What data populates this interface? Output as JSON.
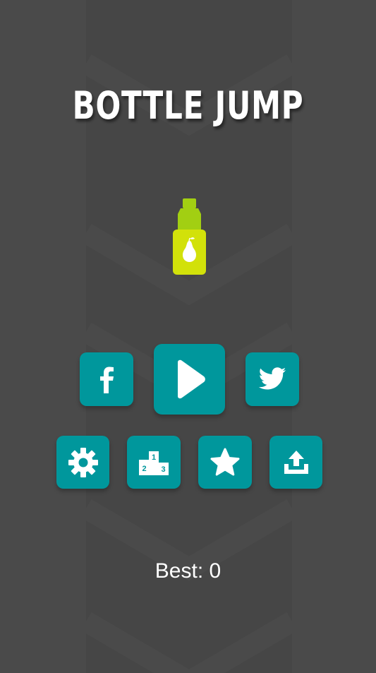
{
  "game": {
    "title": "BOTTLE JUMP",
    "best_label": "Best:",
    "best_value": "0"
  },
  "buttons": {
    "facebook": {
      "icon": "facebook-icon"
    },
    "play": {
      "icon": "play-icon"
    },
    "twitter": {
      "icon": "twitter-icon"
    },
    "settings": {
      "icon": "gear-icon"
    },
    "leaderboard": {
      "icon": "podium-icon"
    },
    "rate": {
      "icon": "star-icon"
    },
    "share": {
      "icon": "share-icon"
    }
  },
  "podium_labels": {
    "first": "1",
    "second": "2",
    "third": "3"
  },
  "colors": {
    "background": "#4a4a4a",
    "stripe": "#464646",
    "button": "#00979c",
    "bottle_body": "#d2e10a",
    "bottle_cap": "#a2cf12",
    "text": "#ffffff"
  }
}
